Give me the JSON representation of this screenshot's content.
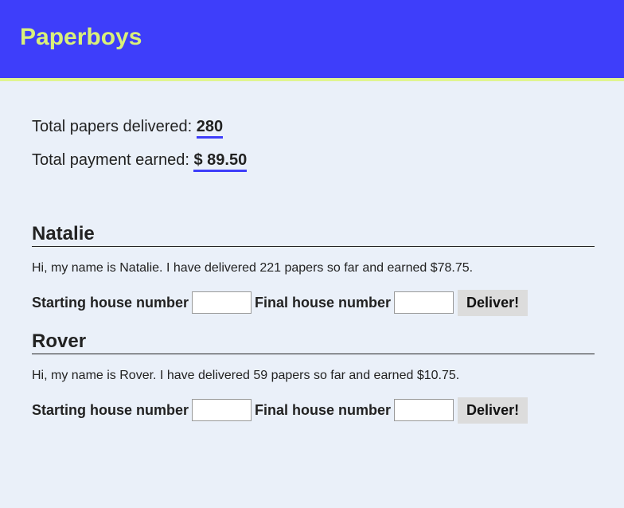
{
  "header": {
    "title": "Paperboys"
  },
  "totals": {
    "papers_label": "Total papers delivered: ",
    "papers_value": "280",
    "payment_label": "Total payment earned: ",
    "payment_value": "$ 89.50"
  },
  "paperboys": [
    {
      "name": "Natalie",
      "intro": "Hi, my name is Natalie. I have delivered 221 papers so far and earned $78.75.",
      "start_label": "Starting house number",
      "start_value": "",
      "final_label": "Final house number",
      "final_value": "",
      "button_label": "Deliver!"
    },
    {
      "name": "Rover",
      "intro": "Hi, my name is Rover. I have delivered 59 papers so far and earned $10.75.",
      "start_label": "Starting house number",
      "start_value": "",
      "final_label": "Final house number",
      "final_value": "",
      "button_label": "Deliver!"
    }
  ],
  "colors": {
    "header_bg": "#3e3efa",
    "header_title": "#d9f07a",
    "header_border": "#e0f590",
    "page_bg": "#eaf0f9",
    "underline_accent": "#3e3efa"
  }
}
